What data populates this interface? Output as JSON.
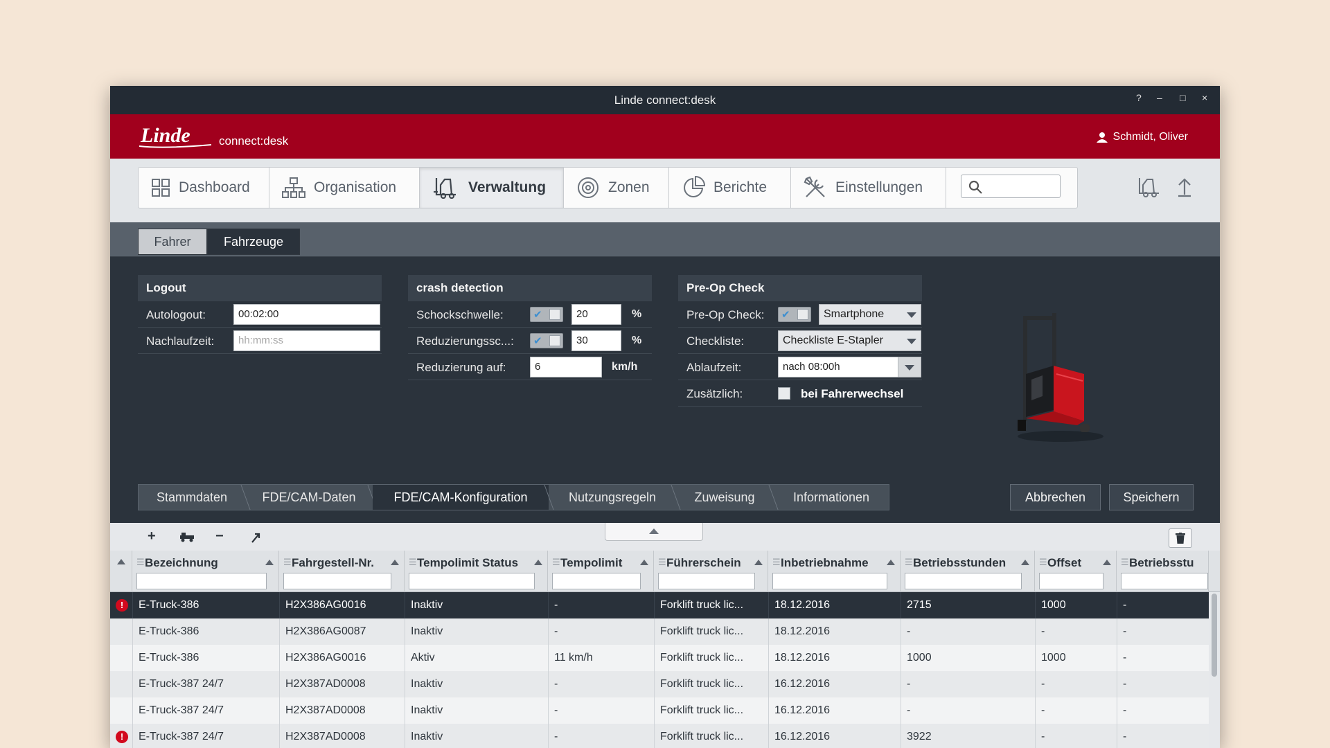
{
  "window": {
    "title": "Linde connect:desk",
    "controls": [
      "?",
      "–",
      "□",
      "×"
    ]
  },
  "brand": {
    "logo_text": "Linde",
    "app_name": "connect:desk",
    "user": "Schmidt, Oliver",
    "color": "#a1001d"
  },
  "nav": {
    "items": [
      {
        "label": "Dashboard",
        "icon": "dashboard-grid-icon"
      },
      {
        "label": "Organisation",
        "icon": "org-chart-icon"
      },
      {
        "label": "Verwaltung",
        "icon": "forklift-icon",
        "active": true
      },
      {
        "label": "Zonen",
        "icon": "target-zone-icon"
      },
      {
        "label": "Berichte",
        "icon": "pie-chart-icon"
      },
      {
        "label": "Einstellungen",
        "icon": "tools-icon"
      }
    ],
    "search_placeholder": "",
    "right_icons": [
      "truck-icon",
      "upload-icon"
    ]
  },
  "subtabs": [
    {
      "label": "Fahrer",
      "active": false
    },
    {
      "label": "Fahrzeuge",
      "active": true
    }
  ],
  "panels": {
    "logout": {
      "title": "Logout",
      "autologout_label": "Autologout:",
      "autologout_value": "00:02:00",
      "nachlauf_label": "Nachlaufzeit:",
      "nachlauf_placeholder": "hh:mm:ss"
    },
    "crash": {
      "title": "crash detection",
      "schock_label": "Schockschwelle:",
      "schock_value": "20",
      "schock_unit": "%",
      "reduz_label": "Reduzierungssc...:",
      "reduz_value": "30",
      "reduz_unit": "%",
      "reduz_auf_label": "Reduzierung auf:",
      "reduz_auf_value": "6",
      "reduz_auf_unit": "km/h"
    },
    "preop": {
      "title": "Pre-Op Check",
      "preop_label": "Pre-Op Check:",
      "preop_value": "Smartphone",
      "checkliste_label": "Checkliste:",
      "checkliste_value": "Checkliste E-Stapler",
      "ablauf_label": "Ablaufzeit:",
      "ablauf_value": "nach 08:00h",
      "zusatz_label": "Zusätzlich:",
      "zusatz_option": "bei Fahrerwechsel"
    }
  },
  "steps": [
    {
      "label": "Stammdaten",
      "active": false
    },
    {
      "label": "FDE/CAM-Daten",
      "active": false
    },
    {
      "label": "FDE/CAM-Konfiguration",
      "active": true
    },
    {
      "label": "Nutzungsregeln",
      "active": false
    },
    {
      "label": "Zuweisung",
      "active": false
    },
    {
      "label": "Informationen",
      "active": false
    }
  ],
  "actions": {
    "cancel": "Abbrechen",
    "save": "Speichern"
  },
  "toolbar": {
    "add": "+",
    "remove": "−"
  },
  "table": {
    "columns": [
      "Bezeichnung",
      "Fahrgestell-Nr.",
      "Tempolimit Status",
      "Tempolimit",
      "Führerschein",
      "Inbetriebnahme",
      "Betriebsstunden",
      "Offset",
      "Betriebsstu"
    ],
    "rows": [
      {
        "error": true,
        "selected": true,
        "cells": [
          "E-Truck-386",
          "H2X386AG0016",
          "Inaktiv",
          "-",
          "Forklift truck lic...",
          "18.12.2016",
          "2715",
          "1000",
          "-"
        ]
      },
      {
        "error": false,
        "selected": false,
        "cells": [
          "E-Truck-386",
          "H2X386AG0087",
          "Inaktiv",
          "-",
          "Forklift truck lic...",
          "18.12.2016",
          "-",
          "-",
          "-"
        ]
      },
      {
        "error": false,
        "selected": false,
        "cells": [
          "E-Truck-386",
          "H2X386AG0016",
          "Aktiv",
          "11 km/h",
          "Forklift truck lic...",
          "18.12.2016",
          "1000",
          "1000",
          "-"
        ]
      },
      {
        "error": false,
        "selected": false,
        "cells": [
          "E-Truck-387 24/7",
          "H2X387AD0008",
          "Inaktiv",
          "-",
          "Forklift truck lic...",
          "16.12.2016",
          "-",
          "-",
          "-"
        ]
      },
      {
        "error": false,
        "selected": false,
        "cells": [
          "E-Truck-387 24/7",
          "H2X387AD0008",
          "Inaktiv",
          "-",
          "Forklift truck lic...",
          "16.12.2016",
          "-",
          "-",
          "-"
        ]
      },
      {
        "error": true,
        "selected": false,
        "cells": [
          "E-Truck-387 24/7",
          "H2X387AD0008",
          "Inaktiv",
          "-",
          "Forklift truck lic...",
          "16.12.2016",
          "3922",
          "-",
          "-"
        ]
      }
    ]
  }
}
